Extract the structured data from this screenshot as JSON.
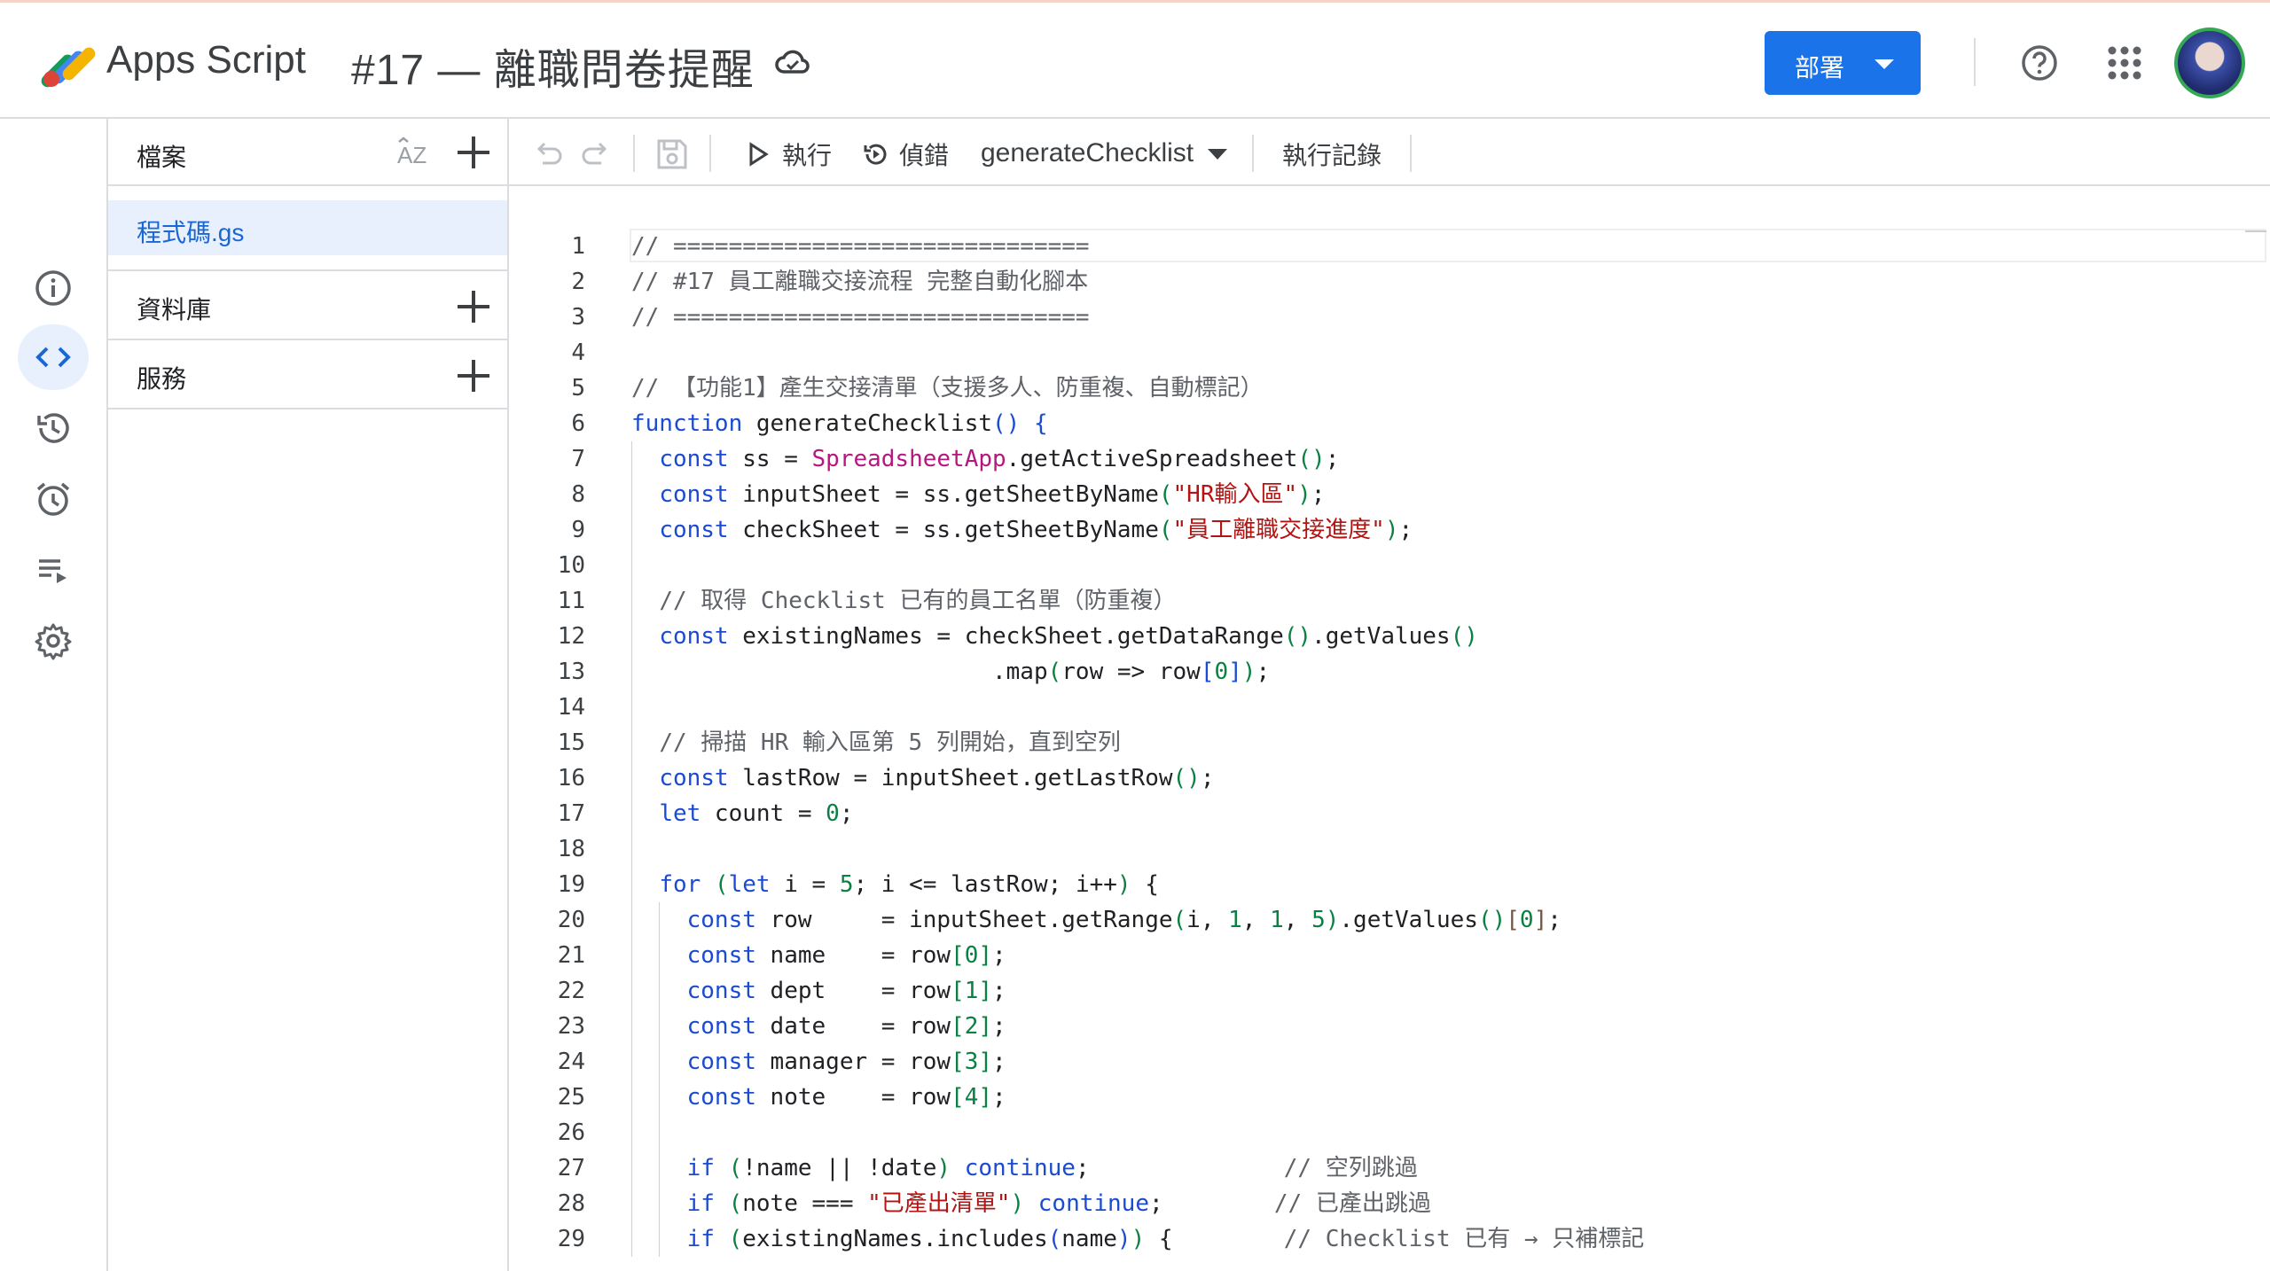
{
  "app": {
    "name": "Apps Script",
    "project_title": "#17 — 離職問卷提醒"
  },
  "header": {
    "deploy_label": "部署"
  },
  "files_panel": {
    "title": "檔案",
    "sort_label": "AZ",
    "file_name": "程式碼.gs",
    "libraries_label": "資料庫",
    "services_label": "服務"
  },
  "toolbar": {
    "run_label": "執行",
    "debug_label": "偵錯",
    "function_name": "generateChecklist",
    "log_label": "執行記錄"
  },
  "colors": {
    "accent": "#1a73e8",
    "active_bg": "#e8f0fe",
    "comment": "#5f6368",
    "keyword": "#1a4bd0",
    "string": "#b31412",
    "number": "#0b8043",
    "class": "#b5177f"
  },
  "icons": [
    "apps-script-logo",
    "cloud-saved-icon",
    "help-icon",
    "apps-grid-icon",
    "avatar",
    "info-icon",
    "code-icon",
    "history-icon",
    "trigger-alarm-icon",
    "executions-icon",
    "settings-gear-icon",
    "sort-az-icon",
    "add-icon",
    "undo-icon",
    "redo-icon",
    "save-icon",
    "play-icon",
    "debug-icon",
    "dropdown-caret-icon"
  ],
  "code": {
    "line_numbers": [
      "1",
      "2",
      "3",
      "4",
      "5",
      "6",
      "7",
      "8",
      "9",
      "10",
      "11",
      "12",
      "13",
      "14",
      "15",
      "16",
      "17",
      "18",
      "19",
      "20",
      "21",
      "22",
      "23",
      "24",
      "25",
      "26",
      "27",
      "28",
      "29"
    ],
    "lines": [
      [
        [
          "// ==============================",
          "com"
        ]
      ],
      [
        [
          "// #17 員工離職交接流程 完整自動化腳本",
          "com"
        ]
      ],
      [
        [
          "// ==============================",
          "com"
        ]
      ],
      [],
      [
        [
          "// 【功能1】產生交接清單（支援多人、防重複、自動標記）",
          "com"
        ]
      ],
      [
        [
          "function",
          "kw"
        ],
        [
          " generateChecklist",
          ""
        ],
        [
          "()",
          "p2"
        ],
        [
          " {",
          "p2"
        ]
      ],
      [
        [
          "  ",
          ""
        ],
        [
          "const",
          "kw"
        ],
        [
          " ss = ",
          ""
        ],
        [
          "SpreadsheetApp",
          "cls"
        ],
        [
          ".getActiveSpreadsheet",
          ""
        ],
        [
          "()",
          "p1"
        ],
        [
          ";",
          ""
        ]
      ],
      [
        [
          "  ",
          ""
        ],
        [
          "const",
          "kw"
        ],
        [
          " inputSheet = ss.getSheetByName",
          ""
        ],
        [
          "(",
          "p1"
        ],
        [
          "\"HR輸入區\"",
          "str"
        ],
        [
          ")",
          "p1"
        ],
        [
          ";",
          ""
        ]
      ],
      [
        [
          "  ",
          ""
        ],
        [
          "const",
          "kw"
        ],
        [
          " checkSheet = ss.getSheetByName",
          ""
        ],
        [
          "(",
          "p1"
        ],
        [
          "\"員工離職交接進度\"",
          "str"
        ],
        [
          ")",
          "p1"
        ],
        [
          ";",
          ""
        ]
      ],
      [],
      [
        [
          "  ",
          ""
        ],
        [
          "// 取得 Checklist 已有的員工名單（防重複）",
          "com"
        ]
      ],
      [
        [
          "  ",
          ""
        ],
        [
          "const",
          "kw"
        ],
        [
          " existingNames = checkSheet.getDataRange",
          ""
        ],
        [
          "()",
          "p1"
        ],
        [
          ".getValues",
          ""
        ],
        [
          "()",
          "p1"
        ]
      ],
      [
        [
          "                          .map",
          ""
        ],
        [
          "(",
          "p1"
        ],
        [
          "row => row",
          ""
        ],
        [
          "[",
          "p2"
        ],
        [
          "0",
          "num"
        ],
        [
          "]",
          "p2"
        ],
        [
          ")",
          "p1"
        ],
        [
          ";",
          ""
        ]
      ],
      [],
      [
        [
          "  ",
          ""
        ],
        [
          "// 掃描 HR 輸入區第 5 列開始，直到空列",
          "com"
        ]
      ],
      [
        [
          "  ",
          ""
        ],
        [
          "const",
          "kw"
        ],
        [
          " lastRow = inputSheet.getLastRow",
          ""
        ],
        [
          "()",
          "p1"
        ],
        [
          ";",
          ""
        ]
      ],
      [
        [
          "  ",
          ""
        ],
        [
          "let",
          "kw"
        ],
        [
          " count = ",
          ""
        ],
        [
          "0",
          "num"
        ],
        [
          ";",
          ""
        ]
      ],
      [],
      [
        [
          "  ",
          ""
        ],
        [
          "for",
          "kw"
        ],
        [
          " ",
          ""
        ],
        [
          "(",
          "p1"
        ],
        [
          "let",
          "kw"
        ],
        [
          " i = ",
          ""
        ],
        [
          "5",
          "num"
        ],
        [
          "; i <= lastRow; i++",
          ""
        ],
        [
          ")",
          "p1"
        ],
        [
          " {",
          ""
        ]
      ],
      [
        [
          "    ",
          ""
        ],
        [
          "const",
          "kw"
        ],
        [
          " row     = inputSheet.getRange",
          ""
        ],
        [
          "(",
          "p1"
        ],
        [
          "i, ",
          ""
        ],
        [
          "1",
          "num"
        ],
        [
          ", ",
          ""
        ],
        [
          "1",
          "num"
        ],
        [
          ", ",
          ""
        ],
        [
          "5",
          "num"
        ],
        [
          ")",
          "p1"
        ],
        [
          ".getValues",
          ""
        ],
        [
          "()",
          "p1"
        ],
        [
          "[",
          "p3"
        ],
        [
          "0",
          "num"
        ],
        [
          "]",
          "p3"
        ],
        [
          ";",
          ""
        ]
      ],
      [
        [
          "    ",
          ""
        ],
        [
          "const",
          "kw"
        ],
        [
          " name    = row",
          ""
        ],
        [
          "[",
          "p1"
        ],
        [
          "0",
          "num"
        ],
        [
          "]",
          "p1"
        ],
        [
          ";",
          ""
        ]
      ],
      [
        [
          "    ",
          ""
        ],
        [
          "const",
          "kw"
        ],
        [
          " dept    = row",
          ""
        ],
        [
          "[",
          "p1"
        ],
        [
          "1",
          "num"
        ],
        [
          "]",
          "p1"
        ],
        [
          ";",
          ""
        ]
      ],
      [
        [
          "    ",
          ""
        ],
        [
          "const",
          "kw"
        ],
        [
          " date    = row",
          ""
        ],
        [
          "[",
          "p1"
        ],
        [
          "2",
          "num"
        ],
        [
          "]",
          "p1"
        ],
        [
          ";",
          ""
        ]
      ],
      [
        [
          "    ",
          ""
        ],
        [
          "const",
          "kw"
        ],
        [
          " manager = row",
          ""
        ],
        [
          "[",
          "p1"
        ],
        [
          "3",
          "num"
        ],
        [
          "]",
          "p1"
        ],
        [
          ";",
          ""
        ]
      ],
      [
        [
          "    ",
          ""
        ],
        [
          "const",
          "kw"
        ],
        [
          " note    = row",
          ""
        ],
        [
          "[",
          "p1"
        ],
        [
          "4",
          "num"
        ],
        [
          "]",
          "p1"
        ],
        [
          ";",
          ""
        ]
      ],
      [],
      [
        [
          "    ",
          ""
        ],
        [
          "if",
          "kw"
        ],
        [
          " ",
          ""
        ],
        [
          "(",
          "p1"
        ],
        [
          "!name || !date",
          ""
        ],
        [
          ")",
          "p1"
        ],
        [
          " ",
          ""
        ],
        [
          "continue",
          "kw"
        ],
        [
          ";              ",
          ""
        ],
        [
          "// 空列跳過",
          "com"
        ]
      ],
      [
        [
          "    ",
          ""
        ],
        [
          "if",
          "kw"
        ],
        [
          " ",
          ""
        ],
        [
          "(",
          "p1"
        ],
        [
          "note === ",
          ""
        ],
        [
          "\"已產出清單\"",
          "str"
        ],
        [
          ")",
          "p1"
        ],
        [
          " ",
          ""
        ],
        [
          "continue",
          "kw"
        ],
        [
          ";        ",
          ""
        ],
        [
          "// 已產出跳過",
          "com"
        ]
      ],
      [
        [
          "    ",
          ""
        ],
        [
          "if",
          "kw"
        ],
        [
          " ",
          ""
        ],
        [
          "(",
          "p1"
        ],
        [
          "existingNames.includes",
          ""
        ],
        [
          "(",
          "p2"
        ],
        [
          "name",
          ""
        ],
        [
          ")",
          "p2"
        ],
        [
          ")",
          "p1"
        ],
        [
          " {        ",
          ""
        ],
        [
          "// Checklist 已有 → 只補標記",
          "com"
        ]
      ]
    ]
  }
}
